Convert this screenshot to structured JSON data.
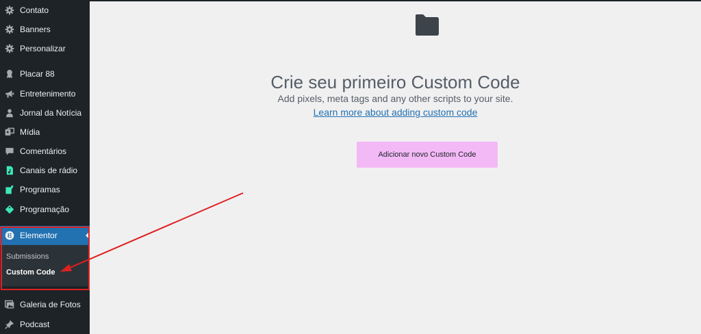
{
  "sidebar": {
    "items": [
      {
        "label": "Contato",
        "icon": "gear-icon"
      },
      {
        "label": "Banners",
        "icon": "gear-icon"
      },
      {
        "label": "Personalizar",
        "icon": "gear-icon"
      },
      {
        "label": "Placar 88",
        "icon": "award-icon"
      },
      {
        "label": "Entretenimento",
        "icon": "megaphone-icon"
      },
      {
        "label": "Jornal da Notícia",
        "icon": "user-icon"
      },
      {
        "label": "Mídia",
        "icon": "media-icon"
      },
      {
        "label": "Comentários",
        "icon": "comment-icon"
      },
      {
        "label": "Canais de rádio",
        "icon": "audio-file-icon"
      },
      {
        "label": "Programas",
        "icon": "edit-page-icon"
      },
      {
        "label": "Programação",
        "icon": "tag-icon"
      },
      {
        "label": "Elementor",
        "icon": "elementor-icon"
      },
      {
        "label": "Galeria de Fotos",
        "icon": "gallery-icon"
      },
      {
        "label": "Podcast",
        "icon": "pin-icon"
      }
    ],
    "submenu": [
      {
        "label": "Submissions"
      },
      {
        "label": "Custom Code"
      }
    ]
  },
  "main": {
    "icon": "folder-icon",
    "title": "Crie seu primeiro Custom Code",
    "description": "Add pixels, meta tags and any other scripts to your site.",
    "learn_link": "Learn more about adding custom code",
    "add_button": "Adicionar novo Custom Code"
  },
  "colors": {
    "sidebar_bg": "#1d2327",
    "active_bg": "#2271b1",
    "button_bg": "#f3b9f6",
    "annotation": "#e02020",
    "link": "#2271b1"
  }
}
